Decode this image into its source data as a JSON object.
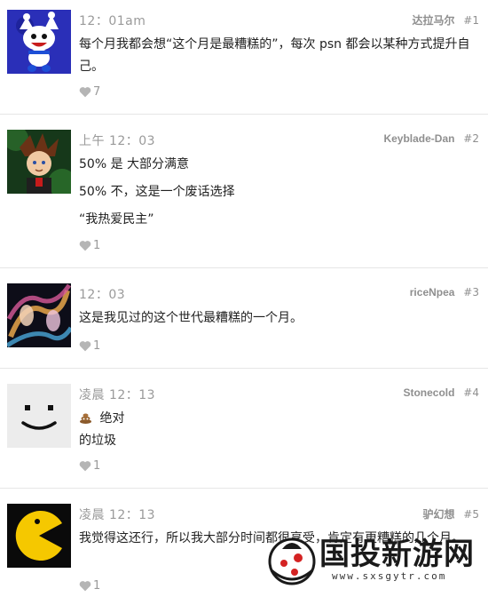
{
  "posts": [
    {
      "time": "12：01am",
      "author": "达拉马尔",
      "number": "#1",
      "lines": [
        "每个月我都会想“这个月是最糟糕的”，每次 psn 都会以某种方式提升自己。"
      ],
      "likes": "7",
      "avatar_icon": "jack-frost-avatar"
    },
    {
      "time": "上午 12：03",
      "author": "Keyblade-Dan",
      "number": "#2",
      "lines": [
        "50% 是 大部分满意",
        "50% 不，这是一个废话选择",
        "“我热爱民主”"
      ],
      "likes": "1",
      "avatar_icon": "sora-avatar"
    },
    {
      "time": "12：03",
      "author": "riceNpea",
      "number": "#3",
      "lines": [
        "这是我见过的这个世代最糟糕的一个月。"
      ],
      "likes": "1",
      "avatar_icon": "swirl-faces-avatar"
    },
    {
      "time": "凌晨 12：13",
      "author": "Stonecold",
      "number": "#4",
      "lines": [
        "绝对",
        "的垃圾"
      ],
      "likes": "1",
      "avatar_icon": "smiley-face-avatar",
      "emoji_icon": "poop-emoji-icon"
    },
    {
      "time": "凌晨 12：13",
      "author": "驴幻想",
      "number": "#5",
      "lines": [
        "我觉得这还行，所以我大部分时间都很享受，肯定有更糟糕的几个月。"
      ],
      "likes": "1",
      "avatar_icon": "pacman-avatar"
    }
  ],
  "watermark": {
    "text": "国投新游网",
    "url": "www.sxsgytr.com"
  },
  "colors": {
    "meta_gray": "#9a9a9a",
    "divider": "#e6e6e6",
    "body_text": "#222222",
    "pacman_yellow": "#f5c800"
  }
}
